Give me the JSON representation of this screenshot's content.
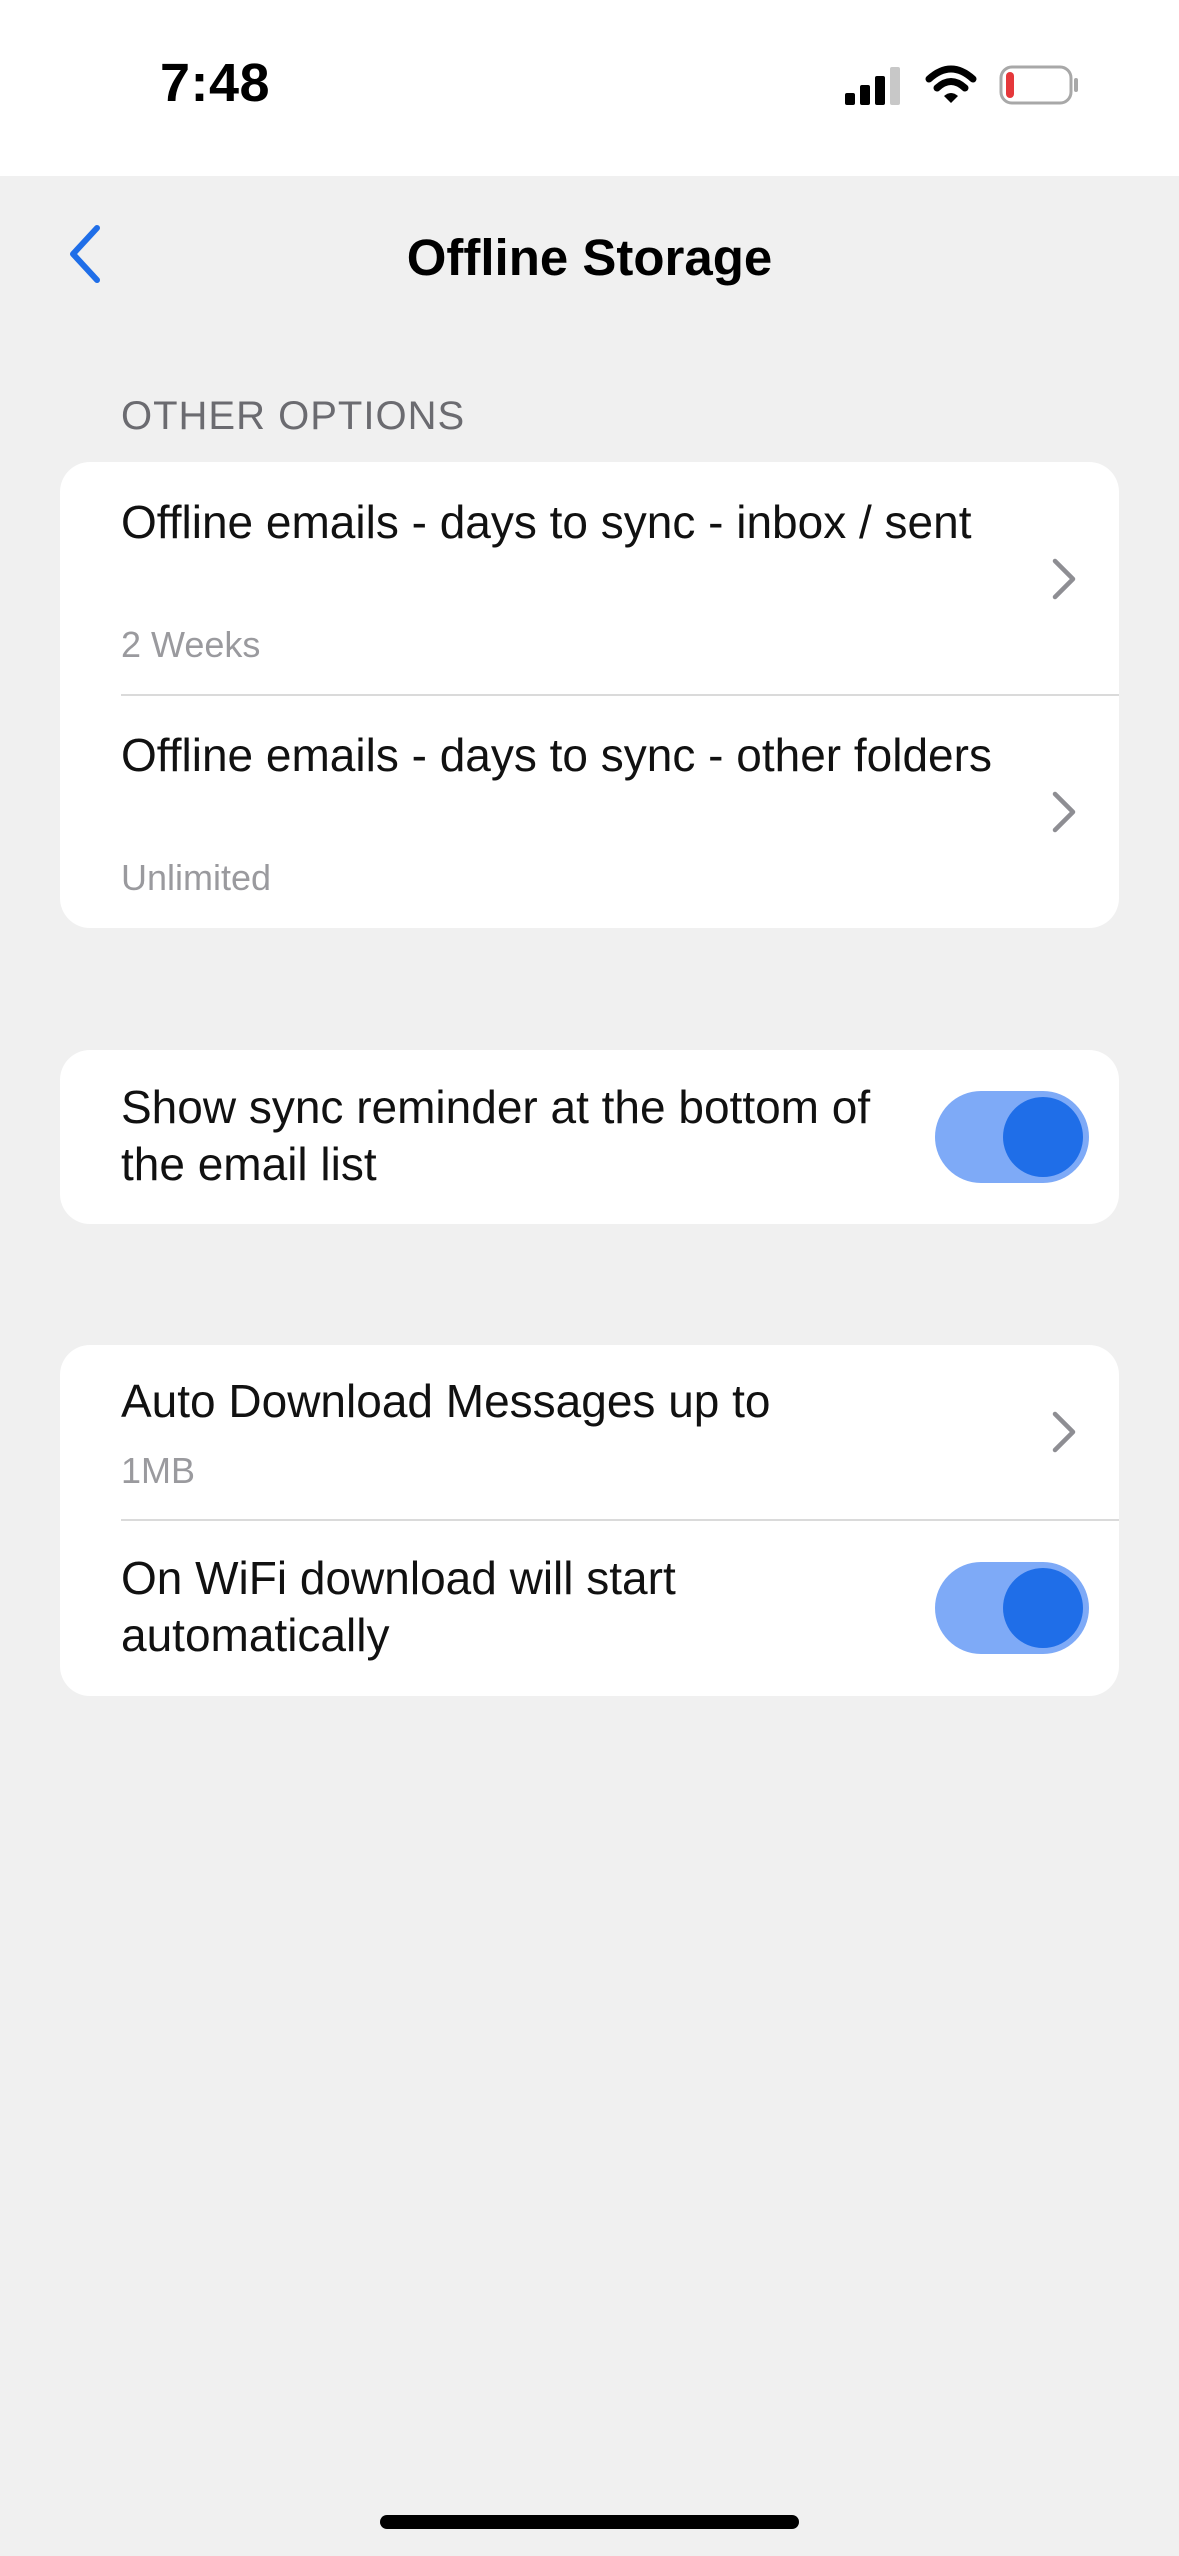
{
  "status_bar": {
    "time": "7:48",
    "icons": [
      "cellular-signal-icon",
      "wifi-icon",
      "battery-low-icon"
    ]
  },
  "nav": {
    "title": "Offline Storage",
    "back_icon": "chevron-left-icon"
  },
  "sections": {
    "other_options": {
      "header": "OTHER OPTIONS",
      "items": [
        {
          "title": "Offline emails - days to sync - inbox / sent",
          "value": "2 Weeks"
        },
        {
          "title": "Offline emails - days to sync - other folders",
          "value": "Unlimited"
        }
      ]
    },
    "sync_reminder": {
      "title": "Show sync reminder at the bottom of the email list",
      "enabled": true
    },
    "download": {
      "auto_download": {
        "title": "Auto Download Messages up to",
        "value": "1MB"
      },
      "wifi_download": {
        "title": "On WiFi download will start automatically",
        "enabled": true
      }
    }
  },
  "colors": {
    "accent": "#1f6ee8",
    "toggle_track": "#7eaaf7",
    "background": "#f0f0f0",
    "secondary_text": "#9a9a9e",
    "battery_low": "#e5383b"
  }
}
